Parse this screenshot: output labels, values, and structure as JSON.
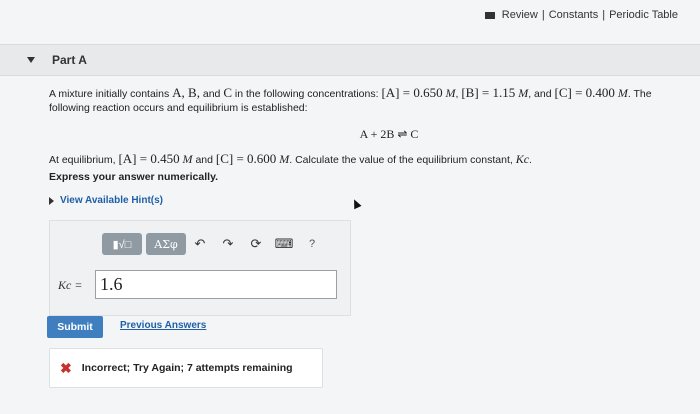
{
  "top_links": {
    "review": "Review",
    "sep1": "|",
    "constants": "Constants",
    "sep2": "|",
    "periodic": "Periodic Table"
  },
  "part": {
    "title": "Part A"
  },
  "problem": {
    "intro": "A mixture initially contains",
    "species": "A, B,",
    "and": "and",
    "c": "C",
    "in_following": "in the following concentrations:",
    "a_conc": "[A] = 0.650",
    "b_conc": "[B] = 1.15",
    "c_conc": "[C] = 0.400",
    "unit": "M",
    "and_word": "and",
    "tail": ". The following reaction occurs and equilibrium is established:",
    "equation": "A + 2B ⇌ C",
    "eq_prefix": "At equilibrium,",
    "eq_a": "[A] = 0.450",
    "eq_and": "and",
    "eq_c": "[C] = 0.600",
    "eq_tail": ". Calculate the value of the equilibrium constant,",
    "kc": "Kc",
    "express": "Express your answer numerically."
  },
  "hint": {
    "label": "View Available Hint(s)"
  },
  "toolbar": {
    "templates": "▮√□",
    "greek": "ΑΣφ",
    "undo": "↶",
    "redo": "↷",
    "reset": "⟳",
    "keyboard": "⌨",
    "help": "?"
  },
  "answer": {
    "label": "Kc =",
    "value": "1.6"
  },
  "buttons": {
    "submit": "Submit",
    "previous": "Previous Answers"
  },
  "feedback": {
    "icon": "✖",
    "message": "Incorrect; Try Again; 7 attempts remaining"
  }
}
